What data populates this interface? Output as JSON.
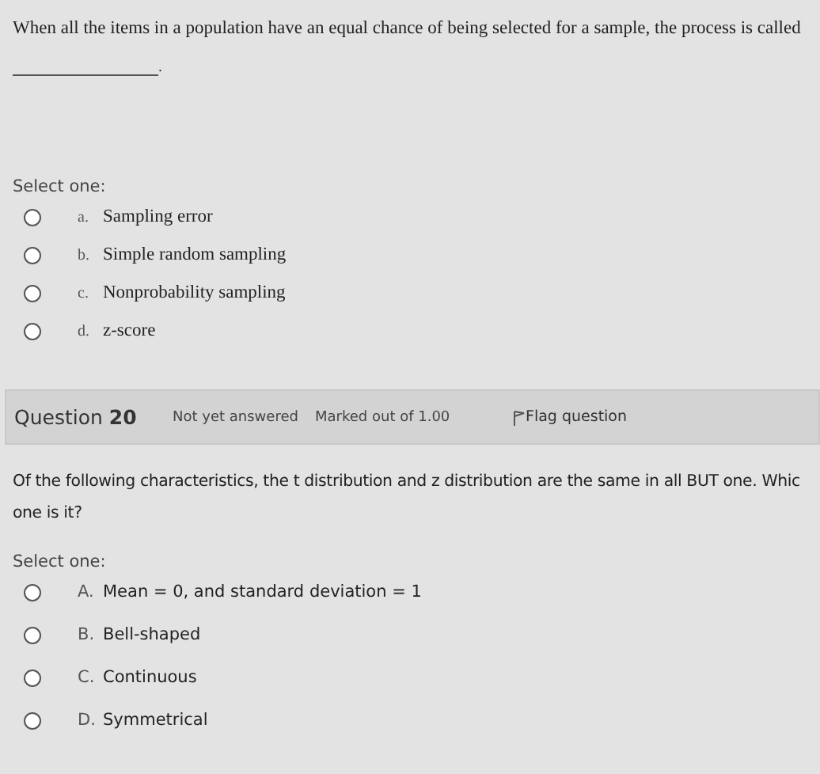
{
  "question_1": {
    "text": "When all the items in a population have an equal chance of being selected for a sample, the process is called",
    "blank_end": ".",
    "prompt": "Select one:",
    "options": [
      {
        "letter": "a.",
        "text": "Sampling error",
        "selected": false
      },
      {
        "letter": "b.",
        "text": "Simple random sampling",
        "selected": false
      },
      {
        "letter": "c.",
        "text": "Nonprobability sampling",
        "selected": false
      },
      {
        "letter": "d.",
        "text": "z-score",
        "selected": false
      }
    ]
  },
  "question_2": {
    "header": {
      "label": "Question",
      "number": "20",
      "status": "Not yet answered",
      "marks": "Marked out of 1.00",
      "flag": "Flag question"
    },
    "text_lines": [
      "Of the following characteristics, the t distribution and z distribution are the same in all BUT one. Whic",
      "one is it?"
    ],
    "prompt": "Select one:",
    "options": [
      {
        "letter": "A.",
        "text": "Mean = 0, and standard deviation = 1",
        "selected": false
      },
      {
        "letter": "B.",
        "text": "Bell-shaped",
        "selected": false
      },
      {
        "letter": "C.",
        "text": "Continuous",
        "selected": false
      },
      {
        "letter": "D.",
        "text": "Symmetrical",
        "selected": false
      }
    ]
  }
}
